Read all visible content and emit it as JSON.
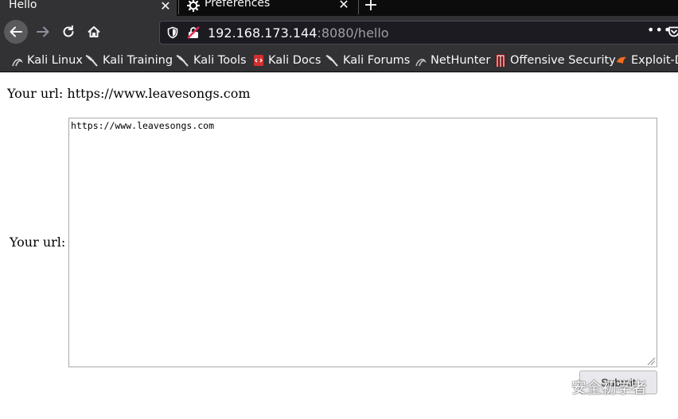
{
  "tabs": [
    {
      "title": "Hello",
      "active": true
    },
    {
      "title": "Preferences",
      "active": false
    }
  ],
  "nav": {
    "url_host": "192.168.173.144",
    "url_rest": ":8080/hello"
  },
  "bookmarks": [
    {
      "label": "Kali Linux",
      "icon": "kali-dragon-icon"
    },
    {
      "label": "Kali Training",
      "icon": "kali-dragon-icon"
    },
    {
      "label": "Kali Tools",
      "icon": "kali-dragon-icon"
    },
    {
      "label": "Kali Docs",
      "icon": "kali-docs-icon"
    },
    {
      "label": "Kali Forums",
      "icon": "kali-dragon-icon"
    },
    {
      "label": "NetHunter",
      "icon": "nethunter-icon"
    },
    {
      "label": "Offensive Security",
      "icon": "offsec-icon"
    },
    {
      "label": "Exploit-D",
      "icon": "exploit-db-icon"
    }
  ],
  "page": {
    "result_text": "Your url: https://www.leavesongs.com",
    "field_label": "Your url:",
    "textarea_value": "https://www.leavesongs.com",
    "submit_label": "Submit"
  },
  "watermark": {
    "text": "安全初学者"
  }
}
